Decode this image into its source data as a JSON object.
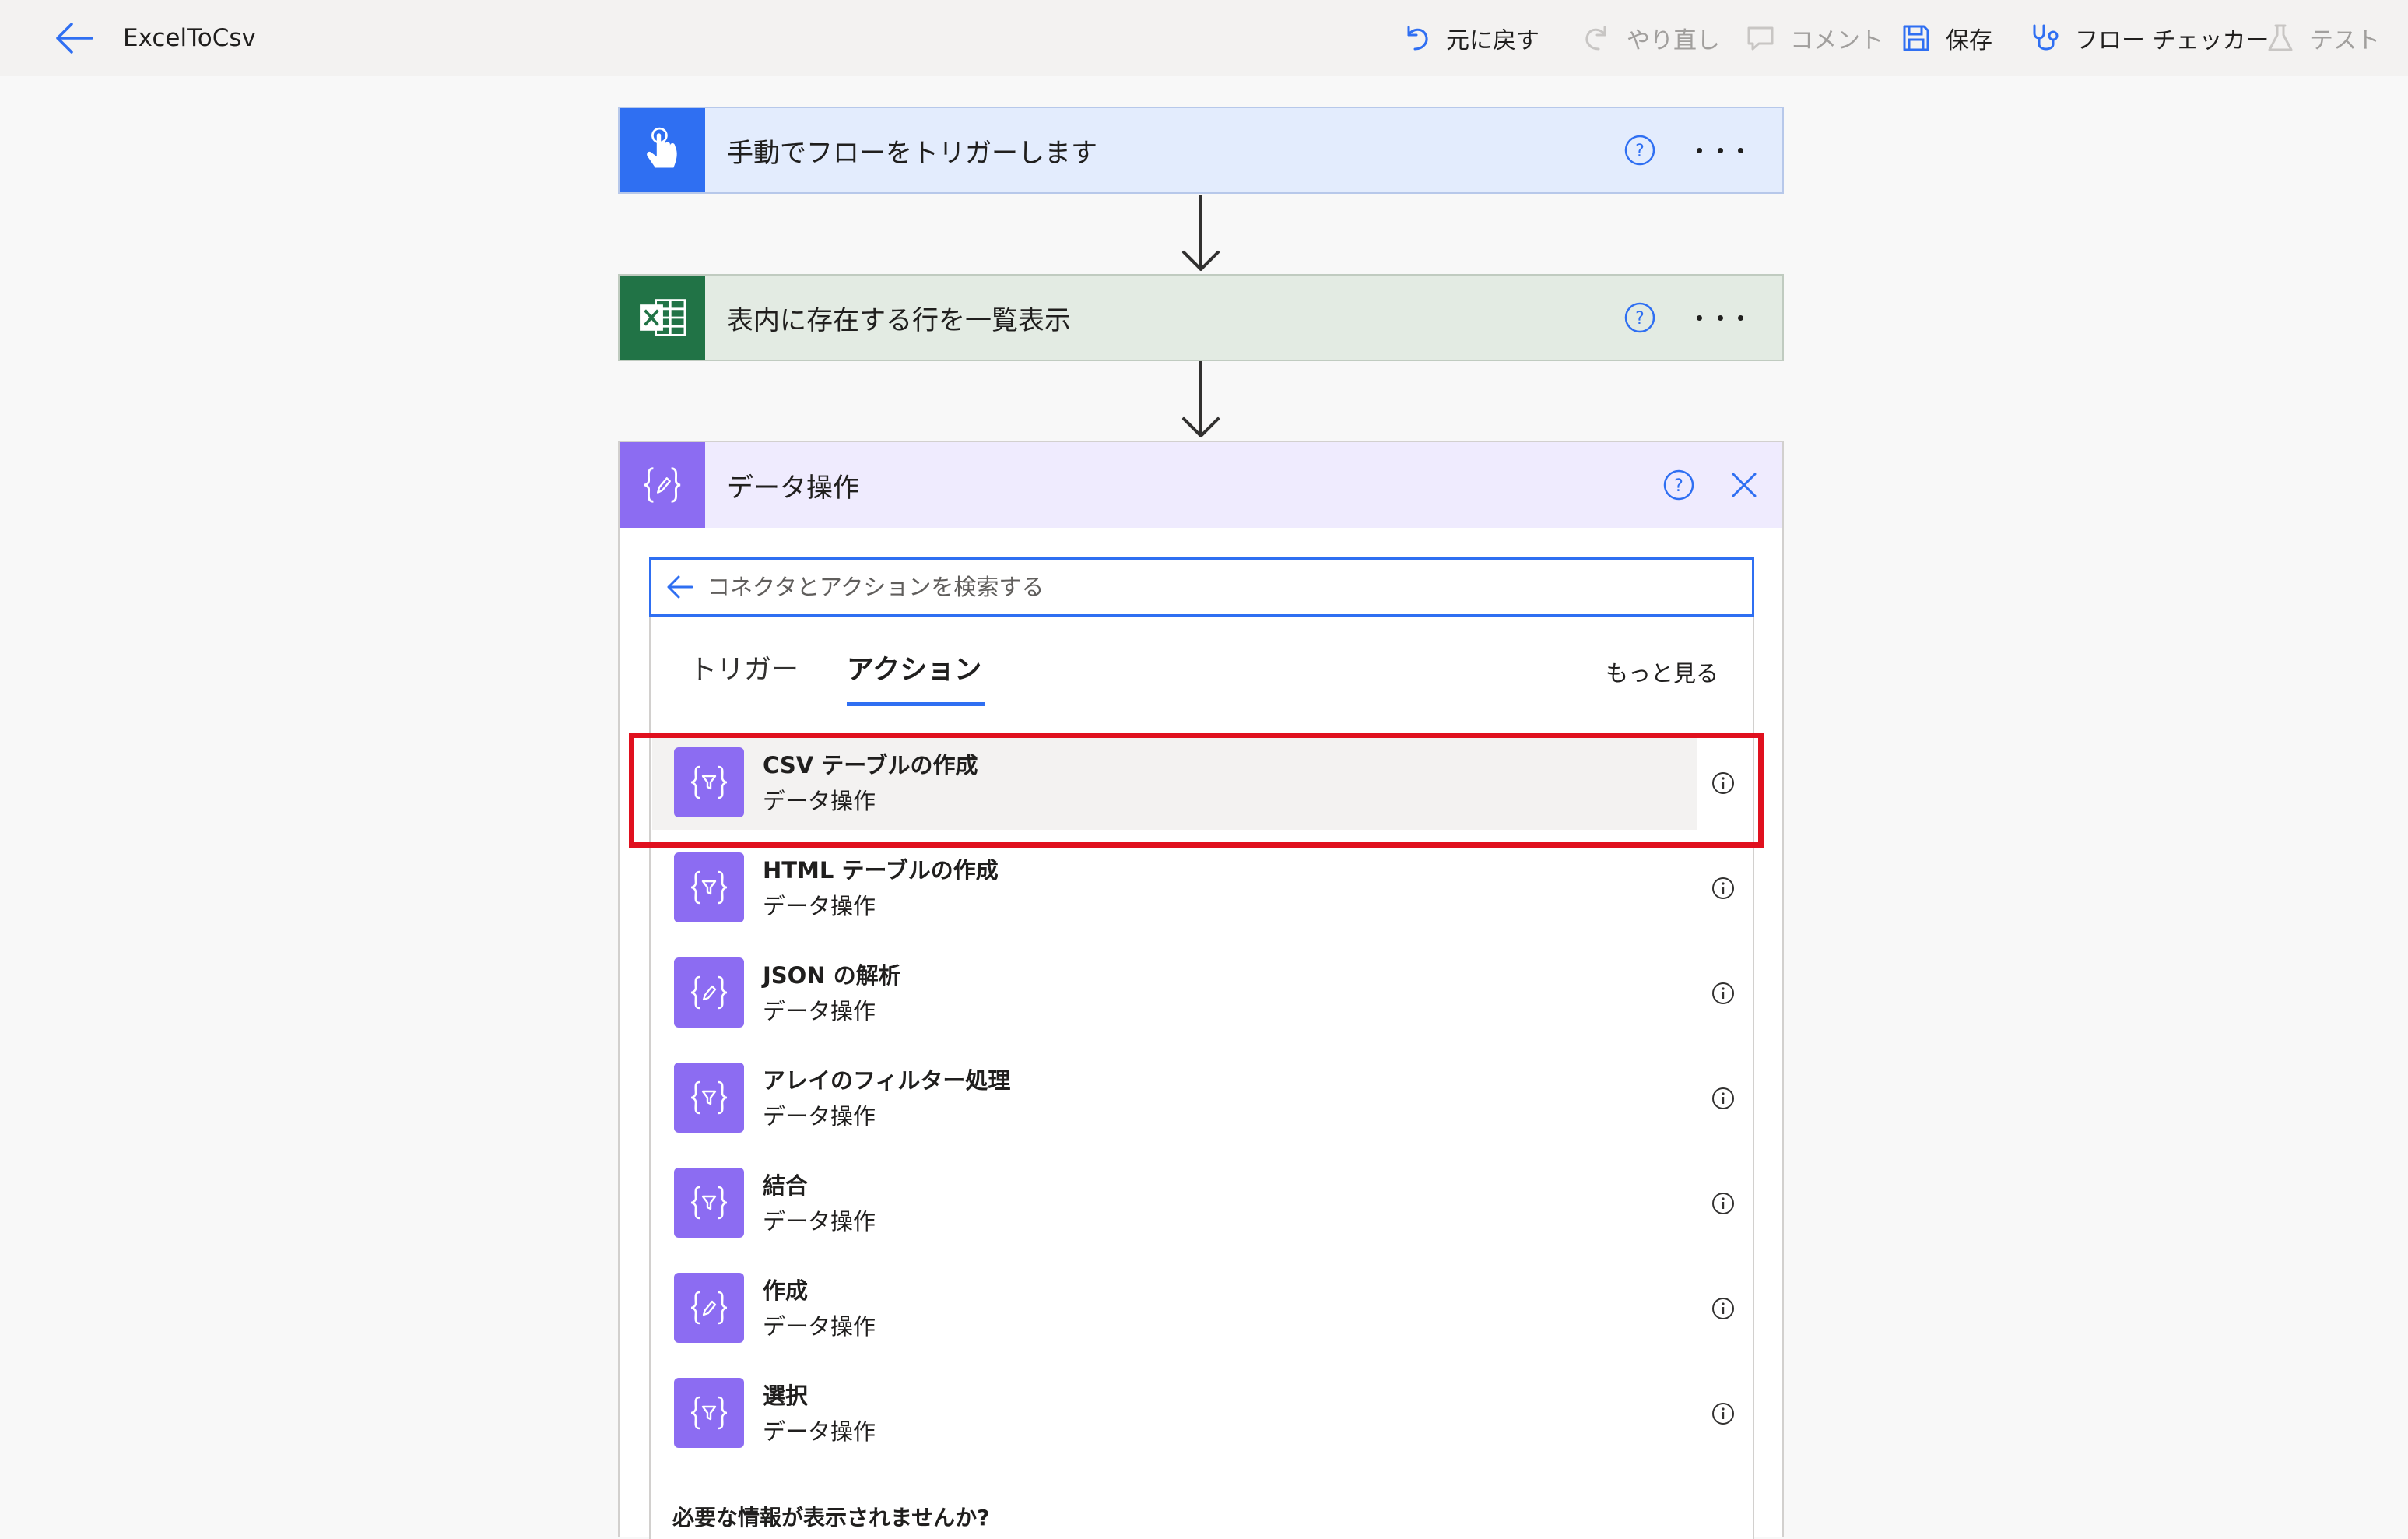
{
  "app": {
    "title": "ExcelToCsv"
  },
  "toolbar": {
    "undo": "元に戻す",
    "redo": "やり直し",
    "comment": "コメント",
    "save": "保存",
    "flow_checker": "フロー チェッカー",
    "test": "テスト"
  },
  "flow": {
    "trigger": {
      "title": "手動でフローをトリガーします"
    },
    "excel": {
      "title": "表内に存在する行を一覧表示"
    }
  },
  "panel": {
    "title": "データ操作",
    "search": {
      "placeholder": "コネクタとアクションを検索する",
      "value": ""
    },
    "tabs": [
      {
        "label": "トリガー",
        "active": false
      },
      {
        "label": "アクション",
        "active": true
      }
    ],
    "see_more": "もっと見る",
    "actions": [
      {
        "title": "CSV テーブルの作成",
        "subtitle": "データ操作",
        "icon": "filter-braces-icon",
        "highlighted": true
      },
      {
        "title": "HTML テーブルの作成",
        "subtitle": "データ操作",
        "icon": "filter-braces-icon"
      },
      {
        "title": "JSON の解析",
        "subtitle": "データ操作",
        "icon": "pencil-braces-icon"
      },
      {
        "title": "アレイのフィルター処理",
        "subtitle": "データ操作",
        "icon": "filter-braces-icon"
      },
      {
        "title": "結合",
        "subtitle": "データ操作",
        "icon": "filter-braces-icon"
      },
      {
        "title": "作成",
        "subtitle": "データ操作",
        "icon": "pencil-braces-icon"
      },
      {
        "title": "選択",
        "subtitle": "データ操作",
        "icon": "filter-braces-icon"
      }
    ],
    "footer_question": "必要な情報が表示されませんか?"
  },
  "colors": {
    "accent": "#2f6ff2",
    "trigger_bg": "#e3ecfd",
    "excel_green": "#217346",
    "excel_bg": "#e3ebe3",
    "data_op_purple": "#8c6cf2",
    "data_op_bg": "#efebfe",
    "highlight_red": "#e0101e"
  }
}
